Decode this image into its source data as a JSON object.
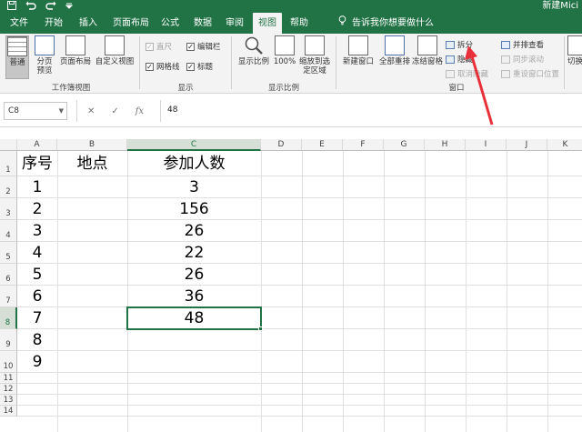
{
  "window": {
    "doc_title": "新建Mici"
  },
  "tabs": [
    {
      "label": "文件"
    },
    {
      "label": "开始"
    },
    {
      "label": "插入"
    },
    {
      "label": "页面布局"
    },
    {
      "label": "公式"
    },
    {
      "label": "数据"
    },
    {
      "label": "审阅"
    },
    {
      "label": "视图"
    },
    {
      "label": "帮助"
    }
  ],
  "tell_me": "告诉我你想要做什么",
  "ribbon": {
    "workbook_views": {
      "normal": "普通",
      "page_break": "分页预览",
      "page_layout": "页面布局",
      "custom": "自定义视图",
      "group": "工作簿视图"
    },
    "show": {
      "ruler": "直尺",
      "formula_bar": "编辑栏",
      "gridlines": "网格线",
      "headings": "标题",
      "group": "显示"
    },
    "zoom": {
      "zoom": "显示比例",
      "hundred": "100%",
      "to_selection": "缩放到选定区域",
      "group": "显示比例"
    },
    "window": {
      "new_window": "新建窗口",
      "arrange_all": "全部重排",
      "freeze": "冻结窗格",
      "split": "拆分",
      "hide": "隐藏",
      "unhide": "取消隐藏",
      "side_by_side": "并排查看",
      "sync_scroll": "同步滚动",
      "reset_pos": "重设窗口位置",
      "switch": "切换",
      "group": "窗口"
    }
  },
  "name_box": "C8",
  "formula_value": "48",
  "columns": [
    "A",
    "B",
    "C",
    "D",
    "E",
    "F",
    "G",
    "H",
    "I",
    "J",
    "K"
  ],
  "rows": [
    "1",
    "2",
    "3",
    "4",
    "5",
    "6",
    "7",
    "8",
    "9",
    "10",
    "11",
    "12",
    "13",
    "14"
  ],
  "sheet": {
    "headers": {
      "a": "序号",
      "b": "地点",
      "c": "参加人数"
    },
    "rows": [
      {
        "a": "1",
        "c": "3"
      },
      {
        "a": "2",
        "c": "156"
      },
      {
        "a": "3",
        "c": "26"
      },
      {
        "a": "4",
        "c": "22"
      },
      {
        "a": "5",
        "c": "26"
      },
      {
        "a": "6",
        "c": "36"
      },
      {
        "a": "7",
        "c": "48"
      },
      {
        "a": "8",
        "c": ""
      },
      {
        "a": "9",
        "c": ""
      }
    ]
  },
  "colors": {
    "accent": "#217346",
    "arrow": "#e8303a"
  }
}
